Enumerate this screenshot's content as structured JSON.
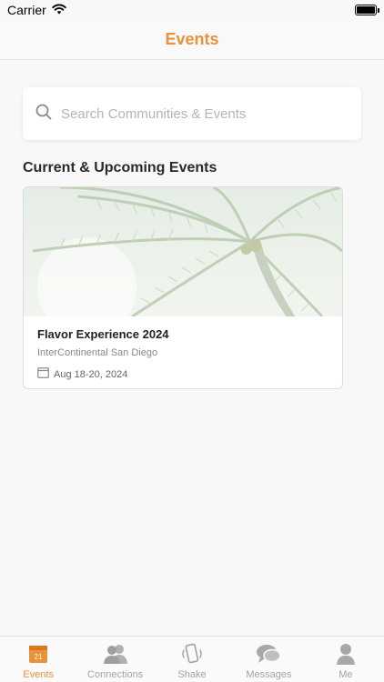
{
  "status_bar": {
    "carrier": "Carrier"
  },
  "nav": {
    "title": "Events"
  },
  "search": {
    "placeholder": "Search Communities & Events",
    "value": ""
  },
  "section": {
    "title": "Current & Upcoming Events"
  },
  "events": [
    {
      "name": "Flavor Experience 2024",
      "venue": "InterContinental San Diego",
      "date": "Aug 18-20, 2024"
    }
  ],
  "tabs": [
    {
      "label": "Events",
      "icon": "calendar-icon",
      "active": true,
      "badge": "21"
    },
    {
      "label": "Connections",
      "icon": "people-icon",
      "active": false
    },
    {
      "label": "Shake",
      "icon": "phone-shake-icon",
      "active": false
    },
    {
      "label": "Messages",
      "icon": "chat-bubbles-icon",
      "active": false
    },
    {
      "label": "Me",
      "icon": "person-icon",
      "active": false
    }
  ],
  "colors": {
    "accent": "#e8923a",
    "inactive": "#a3a3a3"
  }
}
